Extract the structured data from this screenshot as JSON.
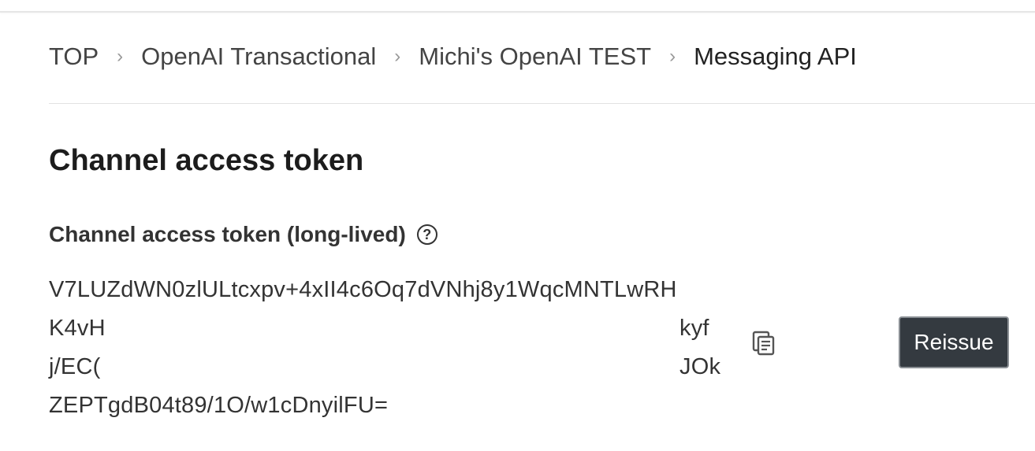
{
  "breadcrumb": {
    "items": [
      "TOP",
      "OpenAI Transactional",
      "Michi's OpenAI TEST",
      "Messaging API"
    ],
    "separator": "›"
  },
  "section": {
    "title": "Channel access token"
  },
  "token_field": {
    "label": "Channel access token (long-lived)",
    "help_icon": "question-circle-icon",
    "lines": [
      "V7LUZdWN0zlULtcxpv+4xII4c6Oq7dVNhj8y1WqcMNTLwRH",
      {
        "left": "K4vH",
        "right": "kyf"
      },
      {
        "left": "j/EC(",
        "right": "JOk"
      },
      "ZEPTgdB04t89/1O/w1cDnyilFU="
    ],
    "copy_icon": "copy-icon",
    "reissue_label": "Reissue"
  }
}
